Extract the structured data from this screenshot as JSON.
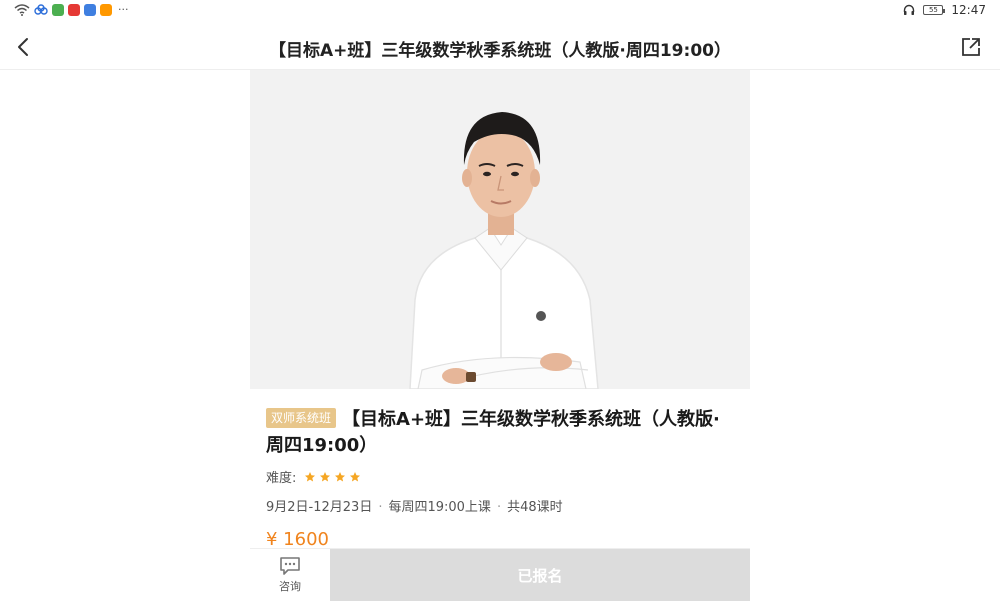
{
  "status_bar": {
    "time": "12:47",
    "battery": "55",
    "app_icon_colors": [
      "#4caf50",
      "#e53935",
      "#3f7fe0",
      "#ff9800"
    ]
  },
  "header": {
    "title": "【目标A+班】三年级数学秋季系统班（人教版·周四19:00）",
    "back_icon": "chevron-left-icon",
    "share_icon": "share-icon"
  },
  "course": {
    "tag": "双师系统班",
    "title": "【目标A+班】三年级数学秋季系统班（人教版·周四19:00）",
    "difficulty_label": "难度:",
    "difficulty_stars": 4,
    "dates": "9月2日-12月23日",
    "weekly": "每周四19:00上课",
    "lessons": "共48课时",
    "separator": "·",
    "price": "¥ 1600"
  },
  "footer": {
    "consult_label": "咨询",
    "enroll_status": "已报名"
  },
  "colors": {
    "accent": "#f0841e",
    "tag_bg": "#e8c68a",
    "star": "#f5a623",
    "disabled_button": "#dcdcdc"
  }
}
